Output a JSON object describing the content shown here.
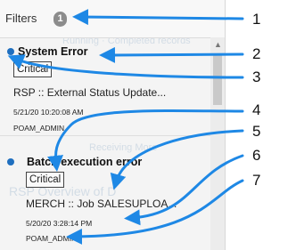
{
  "filters": {
    "label": "Filters",
    "count": "1"
  },
  "items": [
    {
      "title": "System Error",
      "severity": "Critical",
      "description": "RSP :: External Status Update...",
      "timestamp": "5/21/20 10:20:08 AM",
      "user": "POAM_ADMIN"
    },
    {
      "title": "Batch execution error",
      "severity": "Critical",
      "description": "MERCH :: Job SALESUPLOA...",
      "timestamp": "5/20/20 3:28:14 PM",
      "user": "POAM_ADMIN"
    }
  ],
  "callouts": [
    "1",
    "2",
    "3",
    "4",
    "5",
    "6",
    "7"
  ],
  "colors": {
    "arrow": "#1e88e5",
    "unread_dot": "#1f6fbf"
  }
}
